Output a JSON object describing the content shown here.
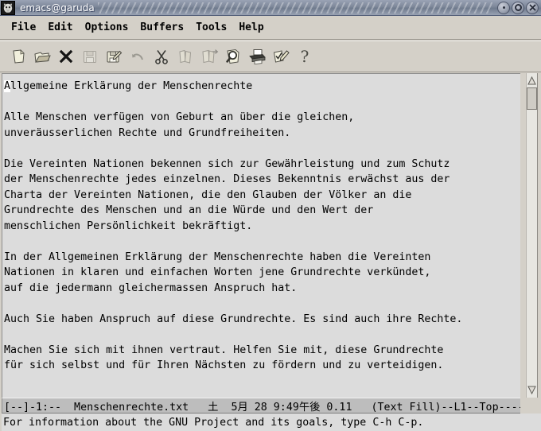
{
  "window": {
    "title": "emacs@garuda",
    "app_icon": "gnu-head-icon",
    "controls": {
      "minimize_label": "●",
      "maximize_label": "○",
      "close_label": "✕"
    }
  },
  "menubar": {
    "items": [
      {
        "name": "file",
        "label": "File"
      },
      {
        "name": "edit",
        "label": "Edit"
      },
      {
        "name": "options",
        "label": "Options"
      },
      {
        "name": "buffers",
        "label": "Buffers"
      },
      {
        "name": "tools",
        "label": "Tools"
      },
      {
        "name": "help",
        "label": "Help"
      }
    ]
  },
  "toolbar": {
    "items": [
      {
        "name": "new-file-icon",
        "label": "New File",
        "enabled": true
      },
      {
        "name": "open-folder-icon",
        "label": "Open File",
        "enabled": true
      },
      {
        "name": "close-x-icon",
        "label": "Close Buffer",
        "enabled": true
      },
      {
        "name": "save-diskette-icon",
        "label": "Save Buffer",
        "enabled": false
      },
      {
        "name": "save-as-icon",
        "label": "Save Buffer As",
        "enabled": true
      },
      {
        "name": "undo-arrow-icon",
        "label": "Undo",
        "enabled": false
      },
      {
        "name": "cut-scissors-icon",
        "label": "Cut",
        "enabled": true
      },
      {
        "name": "copy-icon",
        "label": "Copy",
        "enabled": false
      },
      {
        "name": "paste-icon",
        "label": "Paste",
        "enabled": false
      },
      {
        "name": "search-magnifier-icon",
        "label": "Search",
        "enabled": true
      },
      {
        "name": "print-icon",
        "label": "Print Buffer",
        "enabled": true
      },
      {
        "name": "spell-check-icon",
        "label": "Check Spelling",
        "enabled": true
      },
      {
        "name": "help-question-icon",
        "label": "Help",
        "enabled": true
      }
    ]
  },
  "buffer": {
    "cursor_char": "A",
    "lines": [
      "llgemeine Erklärung der Menschenrechte",
      "",
      "Alle Menschen verfügen von Geburt an über die gleichen,",
      "unveräusserlichen Rechte und Grundfreiheiten.",
      "",
      "Die Vereinten Nationen bekennen sich zur Gewährleistung und zum Schutz",
      "der Menschenrechte jedes einzelnen. Dieses Bekenntnis erwächst aus der",
      "Charta der Vereinten Nationen, die den Glauben der Völker an die",
      "Grundrechte des Menschen und an die Würde und den Wert der",
      "menschlichen Persönlichkeit bekräftigt.",
      "",
      "In der Allgemeinen Erklärung der Menschenrechte haben die Vereinten",
      "Nationen in klaren und einfachen Worten jene Grundrechte verkündet,",
      "auf die jedermann gleichermassen Anspruch hat.",
      "",
      "Auch Sie haben Anspruch auf diese Grundrechte. Es sind auch ihre Rechte.",
      "",
      "Machen Sie sich mit ihnen vertraut. Helfen Sie mit, diese Grundrechte",
      "für sich selbst und für Ihren Nächsten zu fördern und zu verteidigen."
    ]
  },
  "scrollbar": {
    "up_arrow": "△",
    "down_arrow": "▽",
    "thumb_position": "top"
  },
  "modeline": {
    "text": "[--]-1:--  Menschenrechte.txt   土  5月 28 9:49午後 0.11   (Text Fill)--L1--Top-----"
  },
  "echoarea": {
    "text": "For information about the GNU Project and its goals, type C-h C-p."
  },
  "colors": {
    "titlebar_accent": "#7d8799",
    "chrome": "#d4d0c8",
    "buffer_bg": "#dcdcdc",
    "modeline_bg": "#bdbdbd",
    "text": "#000000"
  }
}
